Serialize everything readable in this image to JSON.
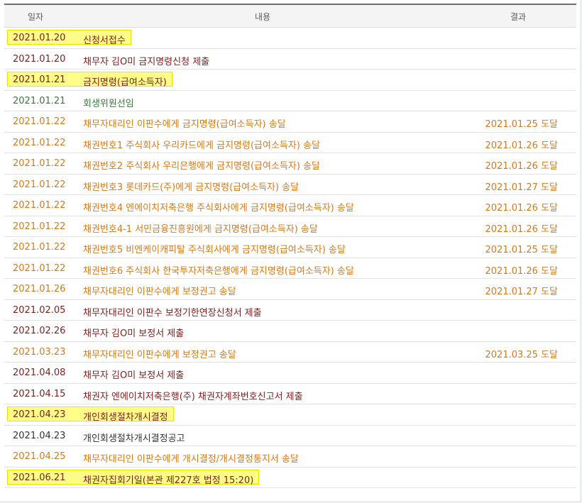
{
  "header": {
    "date": "일자",
    "content": "내용",
    "result": "결과"
  },
  "colors": {
    "orange": "#d57a1a",
    "maroon": "#7b1e1e",
    "green": "#3e7440",
    "dark": "#333333",
    "highlight": "#fdfd88"
  },
  "rows": [
    {
      "date": "2021.01.20",
      "text": "신청서접수",
      "result": "",
      "color": "maroon",
      "highlight": true
    },
    {
      "date": "2021.01.20",
      "text": "채무자 김O미 금지명령신청 제출",
      "result": "",
      "color": "maroon",
      "highlight": false
    },
    {
      "date": "2021.01.21",
      "text": "금지명령(급여소득자)",
      "result": "",
      "color": "maroon",
      "highlight": true
    },
    {
      "date": "2021.01.21",
      "text": "회생위원선임",
      "result": "",
      "color": "green",
      "highlight": false
    },
    {
      "date": "2021.01.22",
      "text": "채무자대리인 이판수에게 금지명령(급여소득자) 송달",
      "result": "2021.01.25 도달",
      "color": "orange",
      "highlight": false
    },
    {
      "date": "2021.01.22",
      "text": "채권번호1 주식회사 우리카드에게 금지명령(급여소득자) 송달",
      "result": "2021.01.26 도달",
      "color": "orange",
      "highlight": false
    },
    {
      "date": "2021.01.22",
      "text": "채권번호2 주식회사 우리은행에게 금지명령(급여소득자) 송달",
      "result": "2021.01.26 도달",
      "color": "orange",
      "highlight": false
    },
    {
      "date": "2021.01.22",
      "text": "채권번호3 롯데카드(주)에게 금지명령(급여소득자) 송달",
      "result": "2021.01.27 도달",
      "color": "orange",
      "highlight": false
    },
    {
      "date": "2021.01.22",
      "text": "채권번호4 엔에이치저축은행 주식회사에게 금지명령(급여소득자) 송달",
      "result": "2021.01.26 도달",
      "color": "orange",
      "highlight": false
    },
    {
      "date": "2021.01.22",
      "text": "채권번호4-1 서민금융진흥원에게 금지명령(급여소득자) 송달",
      "result": "2021.01.26 도달",
      "color": "orange",
      "highlight": false
    },
    {
      "date": "2021.01.22",
      "text": "채권번호5 비엔케이캐피탈 주식회사에게 금지명령(급여소득자) 송달",
      "result": "2021.01.25 도달",
      "color": "orange",
      "highlight": false
    },
    {
      "date": "2021.01.22",
      "text": "채권번호6 주식회사 한국투자저축은행에게 금지명령(급여소득자) 송달",
      "result": "2021.01.26 도달",
      "color": "orange",
      "highlight": false
    },
    {
      "date": "2021.01.26",
      "text": "채무자대리인 이판수에게 보정권고 송달",
      "result": "2021.01.27 도달",
      "color": "orange",
      "highlight": false
    },
    {
      "date": "2021.02.05",
      "text": "채무자대리인 이판수 보정기한연장신청서 제출",
      "result": "",
      "color": "maroon",
      "highlight": false
    },
    {
      "date": "2021.02.26",
      "text": "채무자 김O미 보정서 제출",
      "result": "",
      "color": "maroon",
      "highlight": false
    },
    {
      "date": "2021.03.23",
      "text": "채무자대리인 이판수에게 보정권고 송달",
      "result": "2021.03.25 도달",
      "color": "orange",
      "highlight": false
    },
    {
      "date": "2021.04.08",
      "text": "채무자 김O미 보정서 제출",
      "result": "",
      "color": "maroon",
      "highlight": false
    },
    {
      "date": "2021.04.15",
      "text": "채권자 엔에이치저축은행(주) 채권자계좌번호신고서 제출",
      "result": "",
      "color": "maroon",
      "highlight": false
    },
    {
      "date": "2021.04.23",
      "text": "개인회생절차개시결정",
      "result": "",
      "color": "maroon",
      "highlight": true
    },
    {
      "date": "2021.04.23",
      "text": "개인회생절차개시결정공고",
      "result": "",
      "color": "dark",
      "highlight": false
    },
    {
      "date": "2021.04.25",
      "text": "채무자대리인 이판수에게 개시결정/개시결정통지서 송달",
      "result": "",
      "color": "orange",
      "highlight": false
    },
    {
      "date": "2021.06.21",
      "text": "채권자집회기일(본관 제227호 법정 15:20)",
      "result": "",
      "color": "maroon",
      "highlight": true
    }
  ]
}
